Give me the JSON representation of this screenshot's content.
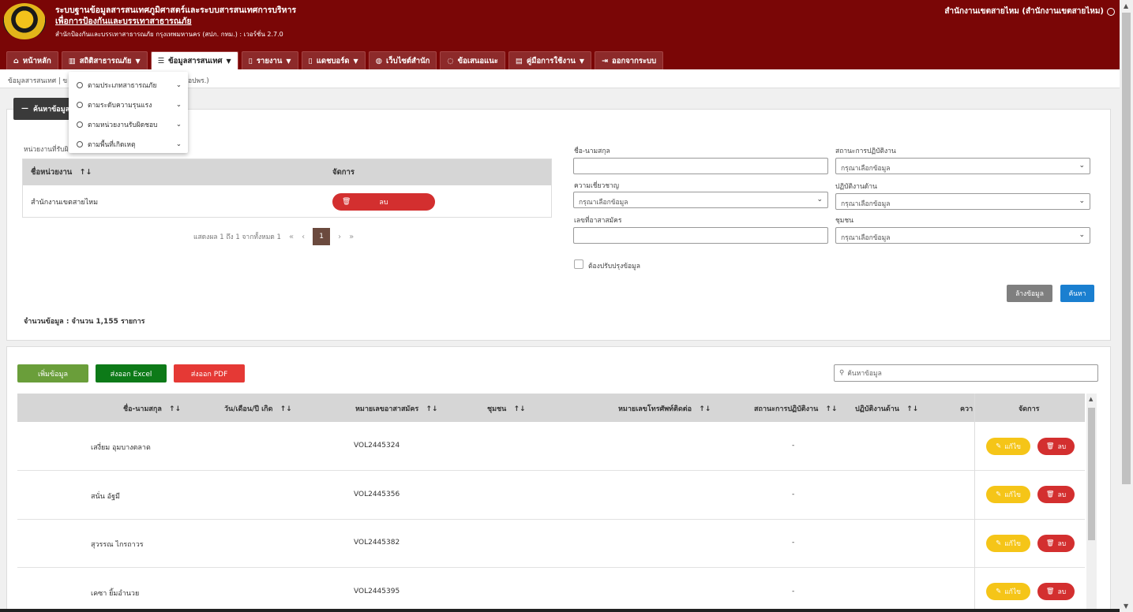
{
  "header": {
    "title_line1": "ระบบฐานข้อมูลสารสนเทศภูมิศาสตร์และระบบสารสนเทศการบริหาร",
    "title_line2": "เพื่อการป้องกันและบรรเทาสาธารณภัย",
    "subtitle": "สำนักป้องกันและบรรเทาสาธารณภัย กรุงเทพมหานคร (สปภ. กทม.) : เวอร์ชั่น 2.7.0",
    "user_label": "สำนักงานเขตสายไหม (สำนักงานเขตสายไหม)"
  },
  "nav": {
    "home": "หน้าหลัก",
    "stats": "สถิติสาธารณภัย",
    "info": "ข้อมูลสารสนเทศ",
    "report": "รายงาน",
    "dashboard": "แดชบอร์ด",
    "website": "เว็บไซต์สำนัก",
    "feedback": "ข้อเสนอแนะ",
    "manual": "คู่มือการใช้งาน",
    "logout": "ออกจากระบบ"
  },
  "breadcrumb": {
    "left": "ข้อมูลสารสนเทศ | ข",
    "right": "อปพร.)"
  },
  "dropdown": {
    "items": [
      "ตามประเภทสาธารณภัย",
      "ตามระดับความรุนแรง",
      "ตามหน่วยงานรับผิดชอบ",
      "ตามพื้นที่เกิดเหตุ"
    ]
  },
  "search_panel": {
    "toggle_label": "ค้นหาข้อมูล",
    "unit_label": "หน่วยงานที่รับผิ",
    "unit_table": {
      "col_name": "ชื่อหน่วยงาน",
      "col_action": "จัดการ",
      "row_name": "สำนักงานเขตสายไหม",
      "delete_label": "ลบ"
    },
    "pager": {
      "summary": "แสดงผล 1 ถึง 1 จากทั้งหมด 1",
      "first": "«",
      "prev": "‹",
      "current": "1",
      "next": "›",
      "last": "»"
    },
    "count_line": "จำนวนข้อมูล :   จำนวน 1,155 รายการ",
    "fields": {
      "name_label": "ชื่อ-นามสกุล",
      "name_value": "",
      "status_label": "สถานะการปฏิบัติงาน",
      "status_placeholder": "กรุณาเลือกข้อมูล",
      "expertise_label": "ความเชี่ยวชาญ",
      "expertise_placeholder": "กรุณาเลือกข้อมูล",
      "duty_label": "ปฏิบัติงานด้าน",
      "duty_placeholder": "กรุณาเลือกข้อมูล",
      "volunteer_no_label": "เลขที่อาสาสมัคร",
      "volunteer_no_value": "",
      "community_label": "ชุมชน",
      "community_placeholder": "กรุณาเลือกข้อมูล",
      "update_checkbox_label": "ต้องปรับปรุงข้อมูล"
    },
    "clear_button": "ล้างข้อมูล",
    "search_button": "ค้นหา"
  },
  "results": {
    "add_button": "เพิ่มข้อมูล",
    "excel_button": "ส่งออก Excel",
    "pdf_button": "ส่งออก PDF",
    "search_placeholder": "ค้นหาข้อมูล",
    "columns": {
      "name": "ชื่อ-นามสกุล",
      "birthdate": "วัน/เดือน/ปี เกิด",
      "volunteer_no": "หมายเลขอาสาสมัคร",
      "community": "ชุมชน",
      "phone": "หมายเลขโทรศัพท์ติดต่อ",
      "status": "สถานะการปฏิบัติงาน",
      "duty": "ปฏิบัติงานด้าน",
      "expertise_trunc": "ควา",
      "action": "จัดการ"
    },
    "sort_icon": "↑↓",
    "edit_label": "แก้ไข",
    "delete_label": "ลบ",
    "rows": [
      {
        "name": "เสงี่ยม อุมบางตลาด",
        "volunteer_no": "VOL2445324",
        "status": "-"
      },
      {
        "name": "สนั่น อัฐมี",
        "volunteer_no": "VOL2445356",
        "status": "-"
      },
      {
        "name": "สุวรรณ ไกรถาวร",
        "volunteer_no": "VOL2445382",
        "status": "-"
      },
      {
        "name": "เคซา ยิ้มอำนวย",
        "volunteer_no": "VOL2445395",
        "status": "-"
      }
    ]
  },
  "colors": {
    "header_bg": "#7a0606",
    "add_green": "#6a9e3a",
    "excel_green": "#0d7a18",
    "pdf_red": "#e53935",
    "edit_yellow": "#f5c518",
    "delete_red": "#d32f2f",
    "search_blue": "#1a7fd0"
  }
}
